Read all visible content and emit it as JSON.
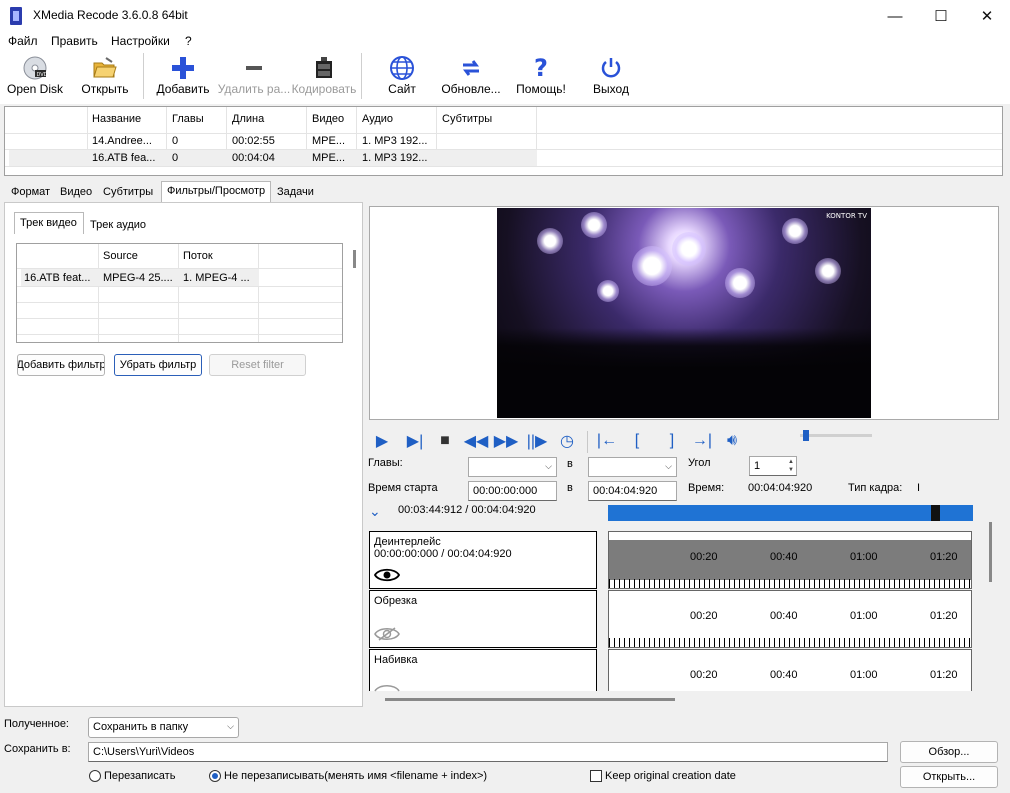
{
  "window": {
    "title": "XMedia Recode 3.6.0.8 64bit",
    "minimize": "—",
    "maximize": "☐",
    "close": "✕"
  },
  "menu": [
    "Файл",
    "Править",
    "Настройки",
    "?"
  ],
  "toolbar": [
    {
      "label": "Open Disk",
      "icon": "disc-icon",
      "enabled": true
    },
    {
      "label": "Открыть",
      "icon": "folder-open-icon",
      "enabled": true
    },
    {
      "label": "Добавить",
      "icon": "plus-icon",
      "enabled": true
    },
    {
      "label": "Удалить ра...",
      "icon": "minus-icon",
      "enabled": false
    },
    {
      "label": "Кодировать",
      "icon": "film-encode-icon",
      "enabled": false
    },
    {
      "label": "Сайт",
      "icon": "globe-icon",
      "enabled": true
    },
    {
      "label": "Обновле...",
      "icon": "refresh-icon",
      "enabled": true
    },
    {
      "label": "Помощь!",
      "icon": "question-icon",
      "enabled": true
    },
    {
      "label": "Выход",
      "icon": "power-icon",
      "enabled": true
    }
  ],
  "filelist": {
    "columns": [
      "Название",
      "Главы",
      "Длина",
      "Видео",
      "Аудио",
      "Субтитры"
    ],
    "rows": [
      [
        "14.Andree...",
        "0",
        "00:02:55",
        "MPE...",
        "1. MP3 192...",
        ""
      ],
      [
        "16.ATB fea...",
        "0",
        "00:04:04",
        "MPE...",
        "1. MP3 192...",
        ""
      ]
    ]
  },
  "tabs": [
    "Формат",
    "Видео",
    "Субтитры",
    "Фильтры/Просмотр",
    "Задачи"
  ],
  "active_tab": "Фильтры/Просмотр",
  "subtabs": [
    "Трек видео",
    "Трек аудио"
  ],
  "tracklist": {
    "columns": [
      "",
      "Source",
      "Поток"
    ],
    "rows": [
      [
        "16.ATB feat...",
        "MPEG-4 25....",
        "1. MPEG-4 ..."
      ]
    ]
  },
  "filter_buttons": {
    "add": "Добавить фильтр",
    "remove": "Убрать фильтр",
    "reset": "Reset filter"
  },
  "preview": {
    "watermark": "KONTOR TV"
  },
  "player_icons": [
    "play-icon",
    "play-to-end-icon",
    "stop-icon",
    "rewind-icon",
    "fast-forward-icon",
    "next-frame-icon",
    "clock-icon",
    "set-start-icon",
    "bracket-left-icon",
    "bracket-right-icon",
    "set-end-icon",
    "volume-icon"
  ],
  "volume_level": 0.05,
  "controls": {
    "chapters_label": "Главы:",
    "to_label": "в",
    "angle_label": "Угол",
    "angle_value": "1",
    "start_time_label": "Время старта",
    "start_time": "00:00:00:000",
    "end_time": "00:04:04:920",
    "time_label": "Время:",
    "time_value": "00:04:04:920",
    "frame_type_label": "Тип кадра:",
    "frame_type_value": "I",
    "position": "00:03:44:912 / 00:04:04:920",
    "progress": 0.907
  },
  "filters": [
    {
      "name": "Деинтерлейс",
      "range": "00:00:00:000 / 00:04:04:920",
      "visible": true
    },
    {
      "name": "Обрезка",
      "range": "",
      "visible": false
    },
    {
      "name": "Набивка",
      "range": "",
      "visible": false
    }
  ],
  "timeline_ticks": [
    "00:20",
    "00:40",
    "01:00",
    "01:20"
  ],
  "bottom": {
    "received_label": "Полученное:",
    "received_value": "Сохранить в папку",
    "save_to_label": "Сохранить в:",
    "save_path": "C:\\Users\\Yuri\\Videos",
    "browse": "Обзор...",
    "open": "Открыть...",
    "overwrite": "Перезаписать",
    "no_overwrite": "Не перезаписывать(менять имя <filename + index>)",
    "keep_date": "Keep original creation date"
  }
}
